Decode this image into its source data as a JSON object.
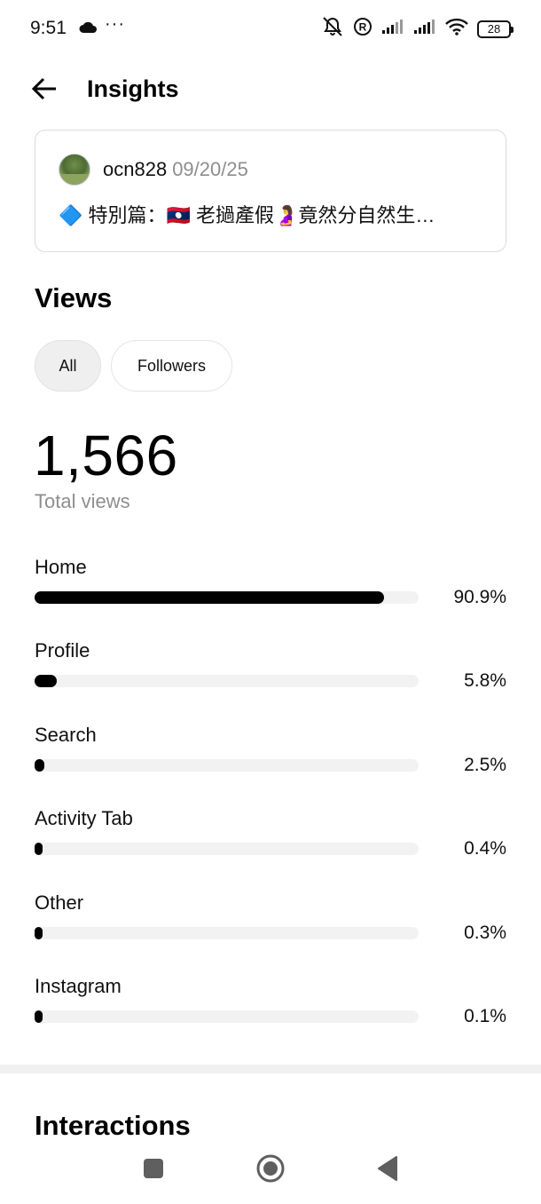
{
  "status_bar": {
    "time": "9:51",
    "more": "···",
    "battery": "28"
  },
  "header": {
    "title": "Insights"
  },
  "post": {
    "username": "ocn828",
    "date": "09/20/25",
    "caption": "🔷 特別篇：🇱🇦 老撾產假🤰竟然分自然生…"
  },
  "views": {
    "title": "Views",
    "filters": [
      {
        "label": "All",
        "active": true
      },
      {
        "label": "Followers",
        "active": false
      }
    ],
    "total": "1,566",
    "total_label": "Total views",
    "sources": [
      {
        "label": "Home",
        "percent_text": "90.9%",
        "percent": 90.9
      },
      {
        "label": "Profile",
        "percent_text": "5.8%",
        "percent": 5.8
      },
      {
        "label": "Search",
        "percent_text": "2.5%",
        "percent": 2.5
      },
      {
        "label": "Activity Tab",
        "percent_text": "0.4%",
        "percent": 0.4
      },
      {
        "label": "Other",
        "percent_text": "0.3%",
        "percent": 0.3
      },
      {
        "label": "Instagram",
        "percent_text": "0.1%",
        "percent": 0.1
      }
    ]
  },
  "interactions": {
    "title": "Interactions"
  },
  "colors": {
    "bar_fill": "#000000",
    "bar_track": "#f2f2f2",
    "muted_text": "#8e8e8e"
  }
}
